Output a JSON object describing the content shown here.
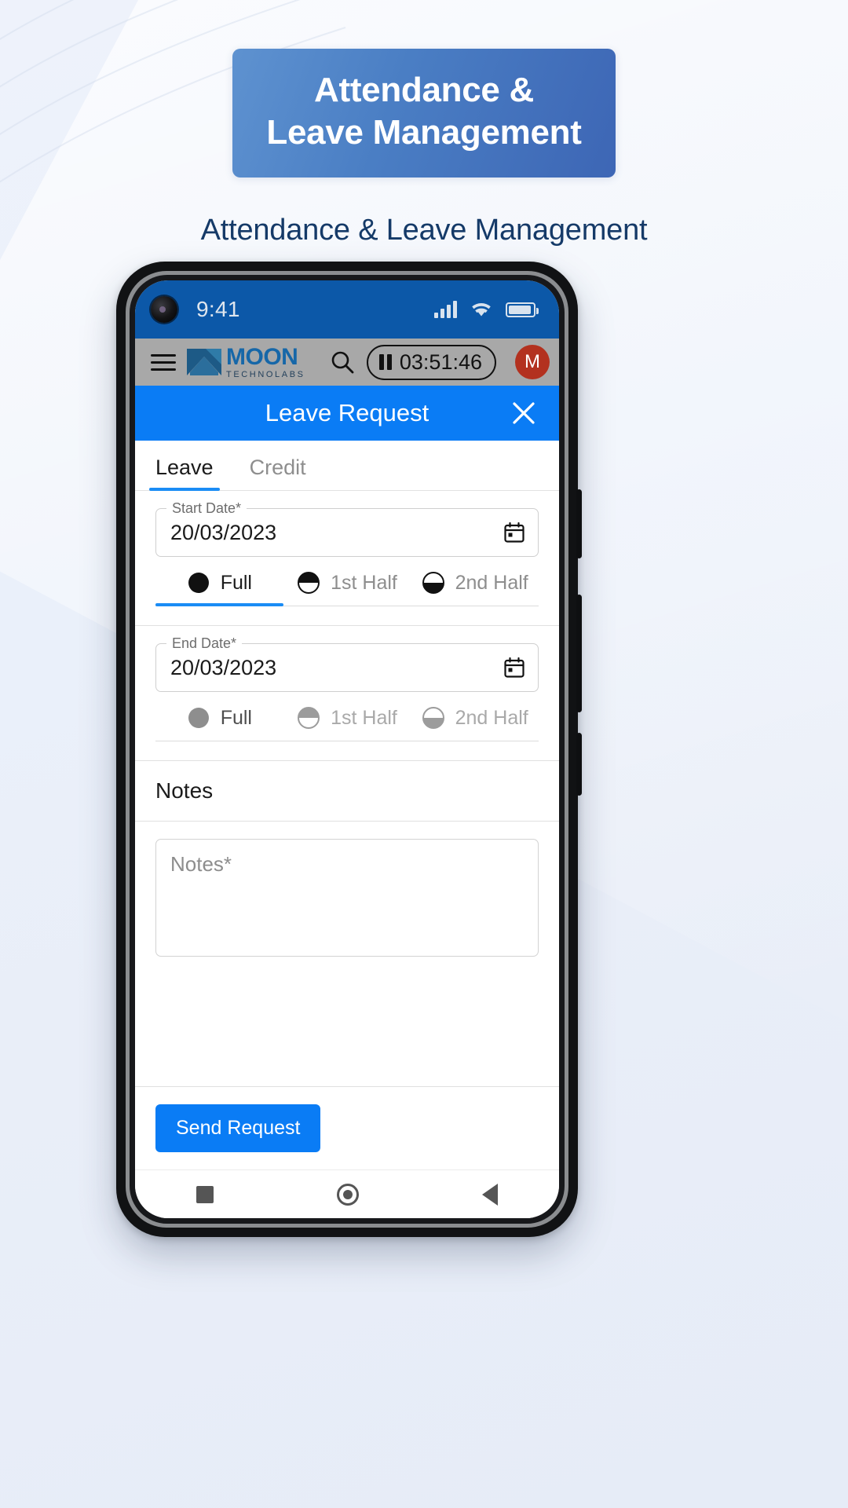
{
  "hero": {
    "badge_lines": [
      "Attendance &",
      "Leave Management"
    ],
    "subtitle": "Attendance & Leave Management",
    "badge_gradient_from": "#5e92d0",
    "badge_gradient_to": "#3d66b5",
    "subtitle_color": "#153a68"
  },
  "phone": {
    "status_bar": {
      "time": "9:41",
      "background": "#0c58a8",
      "signal_icon": "cellular-signal-icon",
      "wifi_icon": "wifi-icon",
      "battery_icon": "battery-icon"
    },
    "app_bar": {
      "menu_icon": "hamburger-menu-icon",
      "logo_main": "MOON",
      "logo_sub": "TECHNOLABS",
      "search_icon": "search-icon",
      "timer_value": "03:51:46",
      "timer_state_icon": "pause-icon",
      "avatar_initial": "M",
      "avatar_color": "#b3311f",
      "background": "#a8a8a8"
    },
    "modal": {
      "title": "Leave Request",
      "close_icon": "close-icon",
      "header_color": "#0a7cf5"
    },
    "tabs": [
      {
        "label": "Leave",
        "active": true
      },
      {
        "label": "Credit",
        "active": false
      }
    ],
    "start_date": {
      "label": "Start Date*",
      "value": "20/03/2023",
      "calendar_icon": "calendar-icon"
    },
    "start_duration": {
      "options": [
        "Full",
        "1st Half",
        "2nd Half"
      ],
      "selected": "Full",
      "enabled": true
    },
    "end_date": {
      "label": "End Date*",
      "value": "20/03/2023",
      "calendar_icon": "calendar-icon"
    },
    "end_duration": {
      "options": [
        "Full",
        "1st Half",
        "2nd Half"
      ],
      "selected": "Full",
      "enabled": false
    },
    "notes_section": {
      "heading": "Notes",
      "placeholder": "Notes*"
    },
    "submit": {
      "label": "Send Request",
      "color": "#0a7cf5"
    },
    "nav_bar": {
      "recents_icon": "square-recents-icon",
      "home_icon": "circle-home-icon",
      "back_icon": "triangle-back-icon"
    }
  }
}
